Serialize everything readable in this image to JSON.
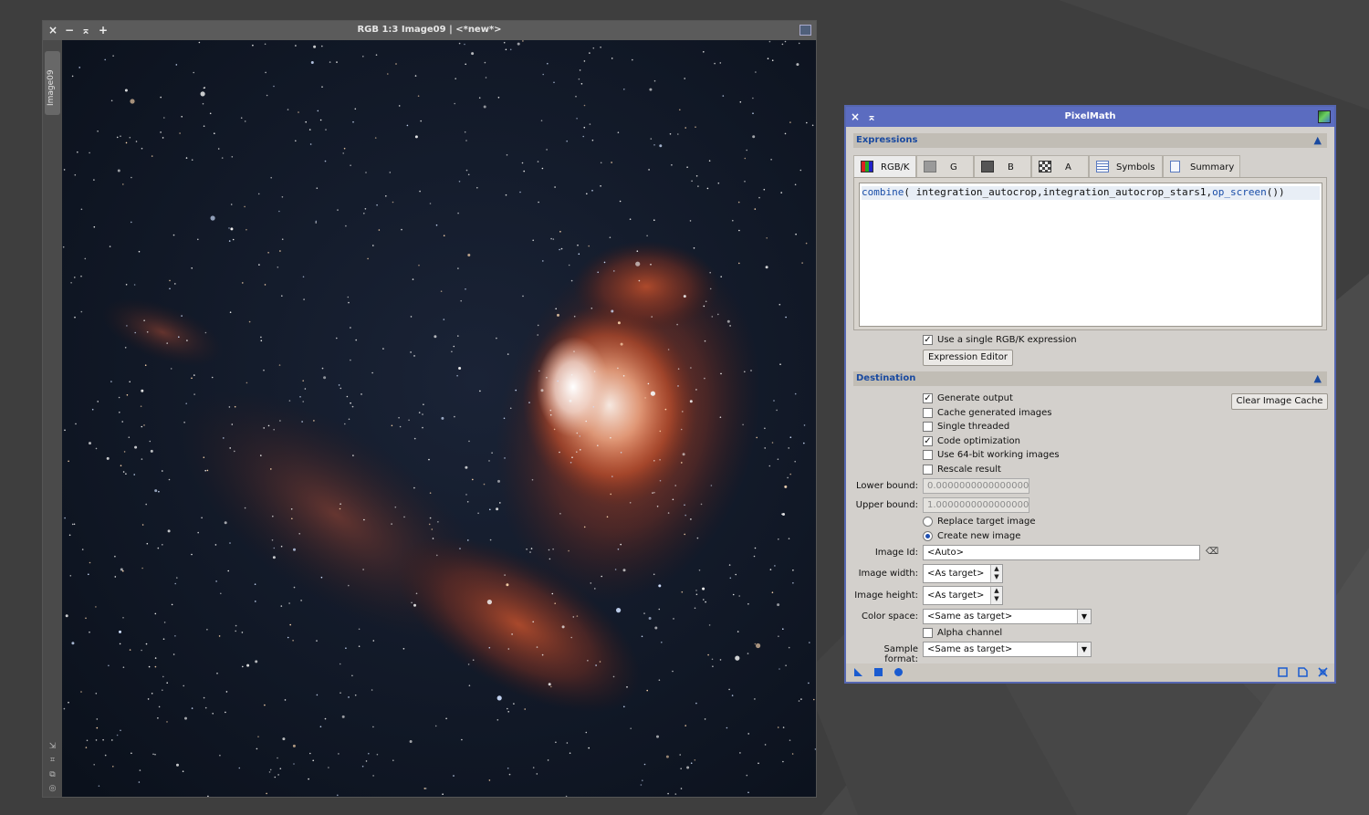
{
  "image_window": {
    "title": "RGB 1:3 Image09 | <*new*>",
    "side_tab_label": "Image09",
    "close_glyph": "×",
    "minimize_glyph": "−",
    "shade_glyph": "⌅",
    "add_glyph": "+"
  },
  "pixelmath": {
    "title": "PixelMath",
    "close_glyph": "×",
    "shade_glyph": "⌅",
    "expressions_section": "Expressions",
    "collapse_glyph": "⏫",
    "tabs": [
      {
        "label": "RGB/K",
        "icon": "rgb-icon"
      },
      {
        "label": "G",
        "icon": "gray-square-icon"
      },
      {
        "label": "B",
        "icon": "dark-square-icon"
      },
      {
        "label": "A",
        "icon": "checker-icon"
      },
      {
        "label": "Symbols",
        "icon": "table-icon"
      },
      {
        "label": "Summary",
        "icon": "document-icon"
      }
    ],
    "expression_fn": "combine",
    "expression_args": "( integration_autocrop,integration_autocrop_stars1,",
    "expression_op": "op_screen",
    "expression_tail": "())",
    "single_rgbk": {
      "label": "Use a single RGB/K expression",
      "checked": true
    },
    "expression_editor_button": "Expression Editor",
    "destination_section": "Destination",
    "clear_cache_button": "Clear Image Cache",
    "options": [
      {
        "label": "Generate output",
        "checked": true
      },
      {
        "label": "Cache generated images",
        "checked": false
      },
      {
        "label": "Single threaded",
        "checked": false
      },
      {
        "label": "Code optimization",
        "checked": true
      },
      {
        "label": "Use 64-bit working images",
        "checked": false
      },
      {
        "label": "Rescale result",
        "checked": false
      }
    ],
    "lower_bound_label": "Lower bound:",
    "lower_bound_value": "0.0000000000000000",
    "upper_bound_label": "Upper bound:",
    "upper_bound_value": "1.0000000000000000",
    "replace_target": {
      "label": "Replace target image",
      "selected": false
    },
    "create_new": {
      "label": "Create new image",
      "selected": true
    },
    "image_id_label": "Image Id:",
    "image_id_value": "<Auto>",
    "image_width_label": "Image width:",
    "image_width_value": "<As target>",
    "image_height_label": "Image height:",
    "image_height_value": "<As target>",
    "color_space_label": "Color space:",
    "color_space_value": "<Same as target>",
    "alpha_channel": {
      "label": "Alpha channel",
      "checked": false
    },
    "sample_format_label": "Sample format:",
    "sample_format_value": "<Same as target>",
    "check_glyph": "✓",
    "accent_color": "#5b6cc0",
    "section_title_color": "#1a4aa0"
  }
}
